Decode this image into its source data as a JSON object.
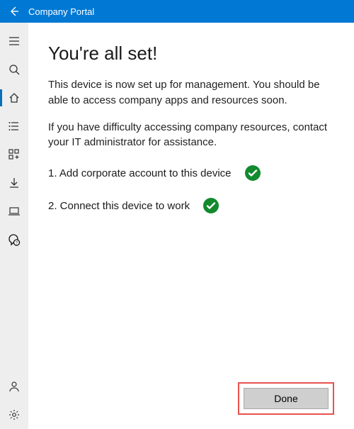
{
  "titlebar": {
    "app_title": "Company Portal"
  },
  "sidebar": {
    "items": [
      {
        "name": "menu-icon"
      },
      {
        "name": "search-icon"
      },
      {
        "name": "home-icon",
        "active": true
      },
      {
        "name": "list-icon"
      },
      {
        "name": "apps-icon"
      },
      {
        "name": "download-icon"
      },
      {
        "name": "device-icon"
      },
      {
        "name": "support-icon"
      }
    ],
    "bottom_items": [
      {
        "name": "user-icon"
      },
      {
        "name": "settings-icon"
      }
    ]
  },
  "main": {
    "heading": "You're all set!",
    "paragraph1": "This device is now set up for management.  You should be able to access company apps and resources soon.",
    "paragraph2": "If you have difficulty accessing company resources, contact your IT administrator for assistance.",
    "steps": [
      {
        "label": "1. Add corporate account to this device",
        "status": "complete"
      },
      {
        "label": "2. Connect this device to work",
        "status": "complete"
      }
    ],
    "done_label": "Done"
  },
  "colors": {
    "accent": "#0078d4",
    "success": "#128a2d",
    "highlight": "#e8524f"
  }
}
